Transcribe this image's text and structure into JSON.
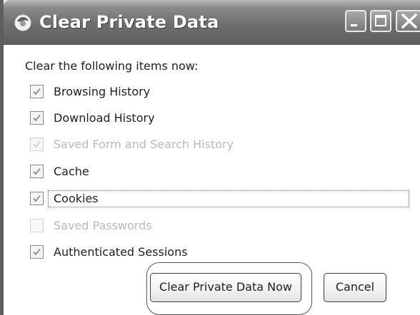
{
  "window": {
    "title": "Clear Private Data",
    "controls": [
      "minimize",
      "maximize",
      "close"
    ]
  },
  "dialog": {
    "intro": "Clear the following items now:",
    "items": [
      {
        "label": "Browsing History",
        "checked": true,
        "enabled": true
      },
      {
        "label": "Download History",
        "checked": true,
        "enabled": true
      },
      {
        "label": "Saved Form and Search History",
        "checked": true,
        "enabled": false
      },
      {
        "label": "Cache",
        "checked": true,
        "enabled": true
      },
      {
        "label": "Cookies",
        "checked": true,
        "enabled": true,
        "focused": true
      },
      {
        "label": "Saved Passwords",
        "checked": false,
        "enabled": false
      },
      {
        "label": "Authenticated Sessions",
        "checked": true,
        "enabled": true
      }
    ]
  },
  "buttons": {
    "clear_now": "Clear Private Data Now",
    "cancel": "Cancel"
  },
  "icons": {
    "app": "firefox-logo-icon",
    "checkbox_mark": "checkmark-icon"
  },
  "colors": {
    "titlebar": "#6e6e6e",
    "title_text": "#ffffff",
    "disabled_text": "#b9b9b9"
  }
}
